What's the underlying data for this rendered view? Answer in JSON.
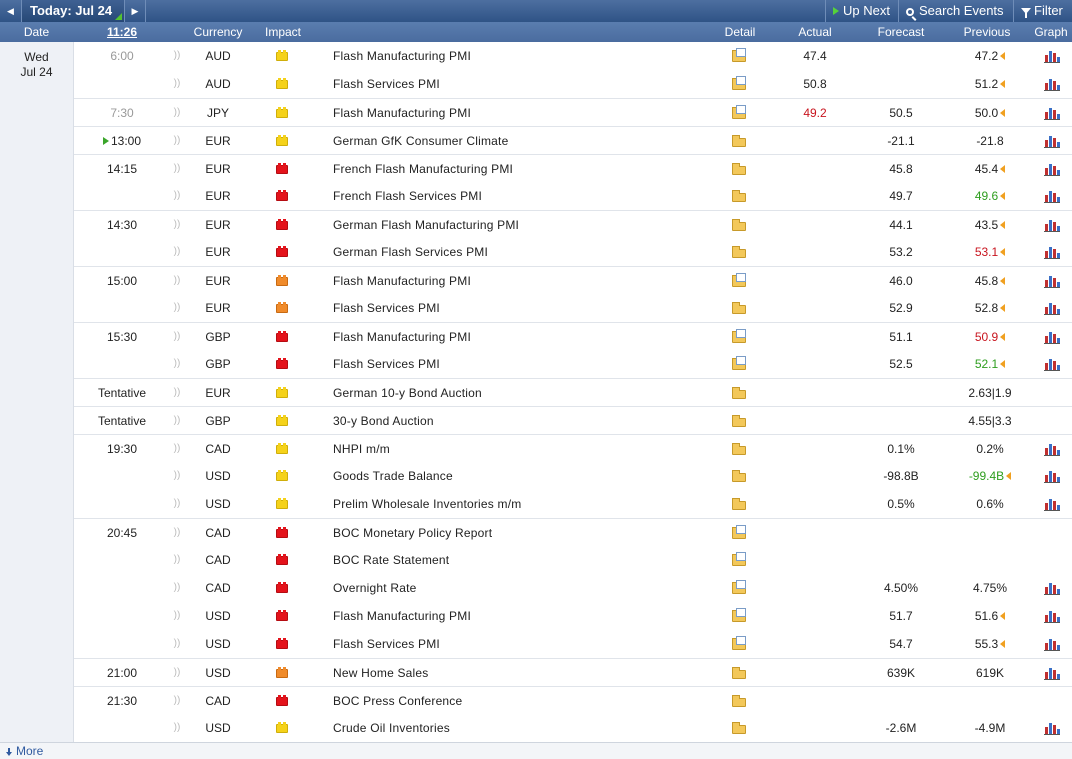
{
  "toolbar": {
    "today_label": "Today: Jul 24",
    "up_next_label": "Up Next",
    "search_label": "Search Events",
    "filter_label": "Filter"
  },
  "header": {
    "date": "Date",
    "clock": "11:26",
    "currency": "Currency",
    "impact": "Impact",
    "detail": "Detail",
    "actual": "Actual",
    "forecast": "Forecast",
    "previous": "Previous",
    "graph": "Graph"
  },
  "date_cell": {
    "day": "Wed",
    "date": "Jul 24"
  },
  "events": [
    {
      "time": "6:00",
      "past": true,
      "currency": "AUD",
      "impact": "low",
      "event": "Flash Manufacturing PMI",
      "detail": "news",
      "actual": "47.4",
      "actual_color": "",
      "forecast": "",
      "previous": "47.2",
      "prev_color": "",
      "revised": true,
      "graph": true,
      "group_start": true
    },
    {
      "time": "",
      "past": true,
      "currency": "AUD",
      "impact": "low",
      "event": "Flash Services PMI",
      "detail": "news",
      "actual": "50.8",
      "actual_color": "",
      "forecast": "",
      "previous": "51.2",
      "prev_color": "",
      "revised": true,
      "graph": true,
      "group_start": false
    },
    {
      "time": "7:30",
      "past": true,
      "currency": "JPY",
      "impact": "low",
      "event": "Flash Manufacturing PMI",
      "detail": "news",
      "actual": "49.2",
      "actual_color": "red",
      "forecast": "50.5",
      "previous": "50.0",
      "prev_color": "",
      "revised": true,
      "graph": true,
      "group_start": true
    },
    {
      "time": "13:00",
      "past": false,
      "upcoming": true,
      "currency": "EUR",
      "impact": "low",
      "event": "German GfK Consumer Climate",
      "detail": "folder",
      "actual": "",
      "actual_color": "",
      "forecast": "-21.1",
      "previous": "-21.8",
      "prev_color": "",
      "revised": false,
      "graph": true,
      "group_start": true
    },
    {
      "time": "14:15",
      "past": false,
      "currency": "EUR",
      "impact": "high",
      "event": "French Flash Manufacturing PMI",
      "detail": "folder",
      "actual": "",
      "actual_color": "",
      "forecast": "45.8",
      "previous": "45.4",
      "prev_color": "",
      "revised": true,
      "graph": true,
      "group_start": true
    },
    {
      "time": "",
      "past": false,
      "currency": "EUR",
      "impact": "high",
      "event": "French Flash Services PMI",
      "detail": "folder",
      "actual": "",
      "actual_color": "",
      "forecast": "49.7",
      "previous": "49.6",
      "prev_color": "green",
      "revised": true,
      "graph": true,
      "group_start": false
    },
    {
      "time": "14:30",
      "past": false,
      "currency": "EUR",
      "impact": "high",
      "event": "German Flash Manufacturing PMI",
      "detail": "folder",
      "actual": "",
      "actual_color": "",
      "forecast": "44.1",
      "previous": "43.5",
      "prev_color": "",
      "revised": true,
      "graph": true,
      "group_start": true
    },
    {
      "time": "",
      "past": false,
      "currency": "EUR",
      "impact": "high",
      "event": "German Flash Services PMI",
      "detail": "folder",
      "actual": "",
      "actual_color": "",
      "forecast": "53.2",
      "previous": "53.1",
      "prev_color": "red",
      "revised": true,
      "graph": true,
      "group_start": false
    },
    {
      "time": "15:00",
      "past": false,
      "currency": "EUR",
      "impact": "medium",
      "event": "Flash Manufacturing PMI",
      "detail": "news",
      "actual": "",
      "actual_color": "",
      "forecast": "46.0",
      "previous": "45.8",
      "prev_color": "",
      "revised": true,
      "graph": true,
      "group_start": true
    },
    {
      "time": "",
      "past": false,
      "currency": "EUR",
      "impact": "medium",
      "event": "Flash Services PMI",
      "detail": "folder",
      "actual": "",
      "actual_color": "",
      "forecast": "52.9",
      "previous": "52.8",
      "prev_color": "",
      "revised": true,
      "graph": true,
      "group_start": false
    },
    {
      "time": "15:30",
      "past": false,
      "currency": "GBP",
      "impact": "high",
      "event": "Flash Manufacturing PMI",
      "detail": "news",
      "actual": "",
      "actual_color": "",
      "forecast": "51.1",
      "previous": "50.9",
      "prev_color": "red",
      "revised": true,
      "graph": true,
      "group_start": true
    },
    {
      "time": "",
      "past": false,
      "currency": "GBP",
      "impact": "high",
      "event": "Flash Services PMI",
      "detail": "news",
      "actual": "",
      "actual_color": "",
      "forecast": "52.5",
      "previous": "52.1",
      "prev_color": "green",
      "revised": true,
      "graph": true,
      "group_start": false
    },
    {
      "time": "Tentative",
      "past": false,
      "currency": "EUR",
      "impact": "low",
      "event": "German 10-y Bond Auction",
      "detail": "folder",
      "actual": "",
      "actual_color": "",
      "forecast": "",
      "previous": "2.63|1.9",
      "prev_color": "",
      "revised": false,
      "graph": false,
      "group_start": true
    },
    {
      "time": "Tentative",
      "past": false,
      "currency": "GBP",
      "impact": "low",
      "event": "30-y Bond Auction",
      "detail": "folder",
      "actual": "",
      "actual_color": "",
      "forecast": "",
      "previous": "4.55|3.3",
      "prev_color": "",
      "revised": false,
      "graph": false,
      "group_start": true
    },
    {
      "time": "19:30",
      "past": false,
      "currency": "CAD",
      "impact": "low",
      "event": "NHPI m/m",
      "detail": "folder",
      "actual": "",
      "actual_color": "",
      "forecast": "0.1%",
      "previous": "0.2%",
      "prev_color": "",
      "revised": false,
      "graph": true,
      "group_start": true
    },
    {
      "time": "",
      "past": false,
      "currency": "USD",
      "impact": "low",
      "event": "Goods Trade Balance",
      "detail": "folder",
      "actual": "",
      "actual_color": "",
      "forecast": "-98.8B",
      "previous": "-99.4B",
      "prev_color": "green",
      "revised": true,
      "graph": true,
      "group_start": false
    },
    {
      "time": "",
      "past": false,
      "currency": "USD",
      "impact": "low",
      "event": "Prelim Wholesale Inventories m/m",
      "detail": "folder",
      "actual": "",
      "actual_color": "",
      "forecast": "0.5%",
      "previous": "0.6%",
      "prev_color": "",
      "revised": false,
      "graph": true,
      "group_start": false
    },
    {
      "time": "20:45",
      "past": false,
      "currency": "CAD",
      "impact": "high",
      "event": "BOC Monetary Policy Report",
      "detail": "news",
      "actual": "",
      "actual_color": "",
      "forecast": "",
      "previous": "",
      "prev_color": "",
      "revised": false,
      "graph": false,
      "group_start": true
    },
    {
      "time": "",
      "past": false,
      "currency": "CAD",
      "impact": "high",
      "event": "BOC Rate Statement",
      "detail": "news",
      "actual": "",
      "actual_color": "",
      "forecast": "",
      "previous": "",
      "prev_color": "",
      "revised": false,
      "graph": false,
      "group_start": false
    },
    {
      "time": "",
      "past": false,
      "currency": "CAD",
      "impact": "high",
      "event": "Overnight Rate",
      "detail": "news",
      "actual": "",
      "actual_color": "",
      "forecast": "4.50%",
      "previous": "4.75%",
      "prev_color": "",
      "revised": false,
      "graph": true,
      "group_start": false
    },
    {
      "time": "",
      "past": false,
      "currency": "USD",
      "impact": "high",
      "event": "Flash Manufacturing PMI",
      "detail": "news",
      "actual": "",
      "actual_color": "",
      "forecast": "51.7",
      "previous": "51.6",
      "prev_color": "",
      "revised": true,
      "graph": true,
      "group_start": false
    },
    {
      "time": "",
      "past": false,
      "currency": "USD",
      "impact": "high",
      "event": "Flash Services PMI",
      "detail": "news",
      "actual": "",
      "actual_color": "",
      "forecast": "54.7",
      "previous": "55.3",
      "prev_color": "",
      "revised": true,
      "graph": true,
      "group_start": false
    },
    {
      "time": "21:00",
      "past": false,
      "currency": "USD",
      "impact": "medium",
      "event": "New Home Sales",
      "detail": "folder",
      "actual": "",
      "actual_color": "",
      "forecast": "639K",
      "previous": "619K",
      "prev_color": "",
      "revised": false,
      "graph": true,
      "group_start": true
    },
    {
      "time": "21:30",
      "past": false,
      "currency": "CAD",
      "impact": "high",
      "event": "BOC Press Conference",
      "detail": "folder",
      "actual": "",
      "actual_color": "",
      "forecast": "",
      "previous": "",
      "prev_color": "",
      "revised": false,
      "graph": false,
      "group_start": true
    },
    {
      "time": "",
      "past": false,
      "currency": "USD",
      "impact": "low",
      "event": "Crude Oil Inventories",
      "detail": "folder",
      "actual": "",
      "actual_color": "",
      "forecast": "-2.6M",
      "previous": "-4.9M",
      "prev_color": "",
      "revised": false,
      "graph": true,
      "group_start": false
    }
  ],
  "footer": {
    "more_label": "More"
  },
  "colors": {
    "toolbar": "#2f5386",
    "header": "#4a6c9f",
    "red": "#c8141e",
    "green": "#2e9e1e",
    "low": "#f5d21a",
    "medium": "#f08b2b",
    "high": "#e4131b"
  }
}
